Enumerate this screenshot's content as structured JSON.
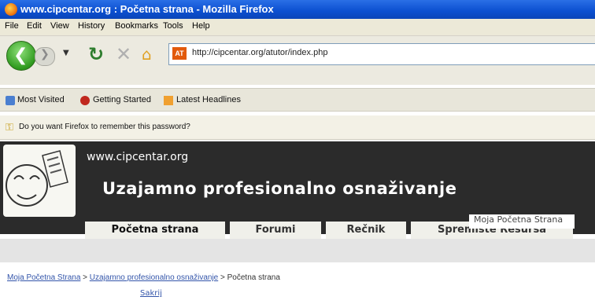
{
  "window": {
    "title": "www.cipcentar.org : Početna strana - Mozilla Firefox"
  },
  "menu": [
    "File",
    "Edit",
    "View",
    "History",
    "Bookmarks",
    "Tools",
    "Help"
  ],
  "nav": {
    "url": "http://cipcentar.org/atutor/index.php",
    "favicon_text": "AT"
  },
  "bookmarks": [
    "Most Visited",
    "Getting Started",
    "Latest Headlines"
  ],
  "password_prompt": "Do you want Firefox to remember this password?",
  "site": {
    "url": "www.cipcentar.org",
    "title": "Uzajamno profesionalno osnaživanje",
    "tabs": [
      "Početna strana",
      "Forumi",
      "Rečnik",
      "Spremište Resursa"
    ],
    "tab_overlay": "Moja Početna Strana"
  },
  "breadcrumb": {
    "link1": "Moja Početna Strana",
    "sep1": " > ",
    "link2": "Uzajamno profesionalno osnaživanje",
    "sep2": " > ",
    "current": "Početna strana"
  },
  "bottom": {
    "link": "Sakrij"
  }
}
